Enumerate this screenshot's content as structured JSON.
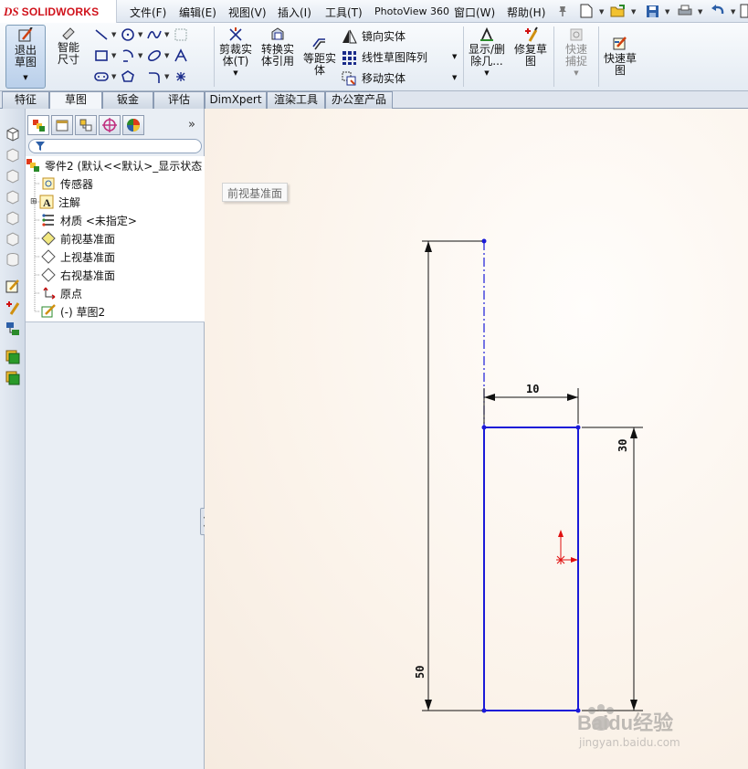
{
  "app": {
    "logo_ds": "DS",
    "logo_text": "SOLIDWORKS"
  },
  "menu": {
    "items": [
      "文件(F)",
      "编辑(E)",
      "视图(V)",
      "插入(I)",
      "工具(T)",
      "PhotoView 360",
      "窗口(W)",
      "帮助(H)"
    ]
  },
  "command_manager": {
    "exit_sketch": "退出草图",
    "smart_dim": "智能尺寸",
    "trim": "剪裁实体(T)",
    "convert": "转换实体引用",
    "offset": "等距实体",
    "mirror": "镜向实体",
    "linear_pattern": "线性草图阵列",
    "move": "移动实体",
    "display_delete": "显示/删除几...",
    "repair": "修复草图",
    "quick_snap": "快速捕捉",
    "rapid_sketch": "快速草图"
  },
  "tabs": {
    "items": [
      "特征",
      "草图",
      "钣金",
      "评估",
      "DimXpert",
      "渲染工具",
      "办公室产品"
    ],
    "active": "草图"
  },
  "feature_tree": {
    "root": "零件2  (默认<<默认>_显示状态",
    "items": [
      {
        "label": "传感器"
      },
      {
        "label": "注解"
      },
      {
        "label": "材质 <未指定>"
      },
      {
        "label": "前视基准面"
      },
      {
        "label": "上视基准面"
      },
      {
        "label": "右视基准面"
      },
      {
        "label": "原点"
      },
      {
        "label": "(-) 草图2"
      }
    ]
  },
  "canvas": {
    "plane_label": "前视基准面",
    "dimensions": {
      "width": "10",
      "height": "30",
      "overall": "50"
    }
  },
  "watermark": {
    "brand": "Baidu经验",
    "url": "jingyan.baidu.com"
  },
  "colors": {
    "sketch_line": "#1a1ad8",
    "dimension": "#000000",
    "origin": "#e01010",
    "accent": "#d0121b"
  }
}
